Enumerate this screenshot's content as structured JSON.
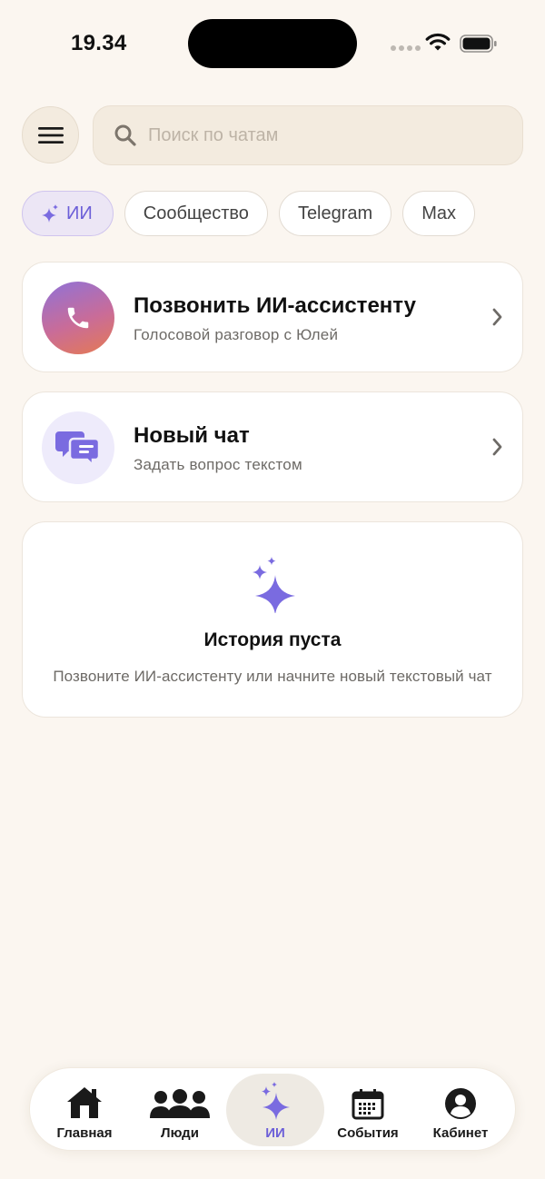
{
  "status_bar": {
    "time": "19.34"
  },
  "search": {
    "placeholder": "Поиск по чатам"
  },
  "filters": [
    {
      "label": "ИИ",
      "active": true
    },
    {
      "label": "Сообщество"
    },
    {
      "label": "Telegram"
    },
    {
      "label": "Max"
    }
  ],
  "actions": {
    "call": {
      "title": "Позвонить ИИ-ассистенту",
      "subtitle": "Голосовой разговор с Юлей"
    },
    "chat": {
      "title": "Новый чат",
      "subtitle": "Задать вопрос текстом"
    }
  },
  "empty_state": {
    "title": "История пуста",
    "text": "Позвоните ИИ-ассистенту или начните новый текстовый чат"
  },
  "tabs": [
    {
      "label": "Главная",
      "icon": "home-icon"
    },
    {
      "label": "Люди",
      "icon": "people-icon"
    },
    {
      "label": "ИИ",
      "icon": "sparkle-icon",
      "active": true
    },
    {
      "label": "События",
      "icon": "calendar-icon"
    },
    {
      "label": "Кабинет",
      "icon": "profile-icon"
    }
  ],
  "colors": {
    "background": "#FBF6F0",
    "accent": "#6C5FD8",
    "chip_active_bg": "#ECE6F5",
    "call_gradient_start": "#8F72D8",
    "call_gradient_end": "#E57A52"
  }
}
